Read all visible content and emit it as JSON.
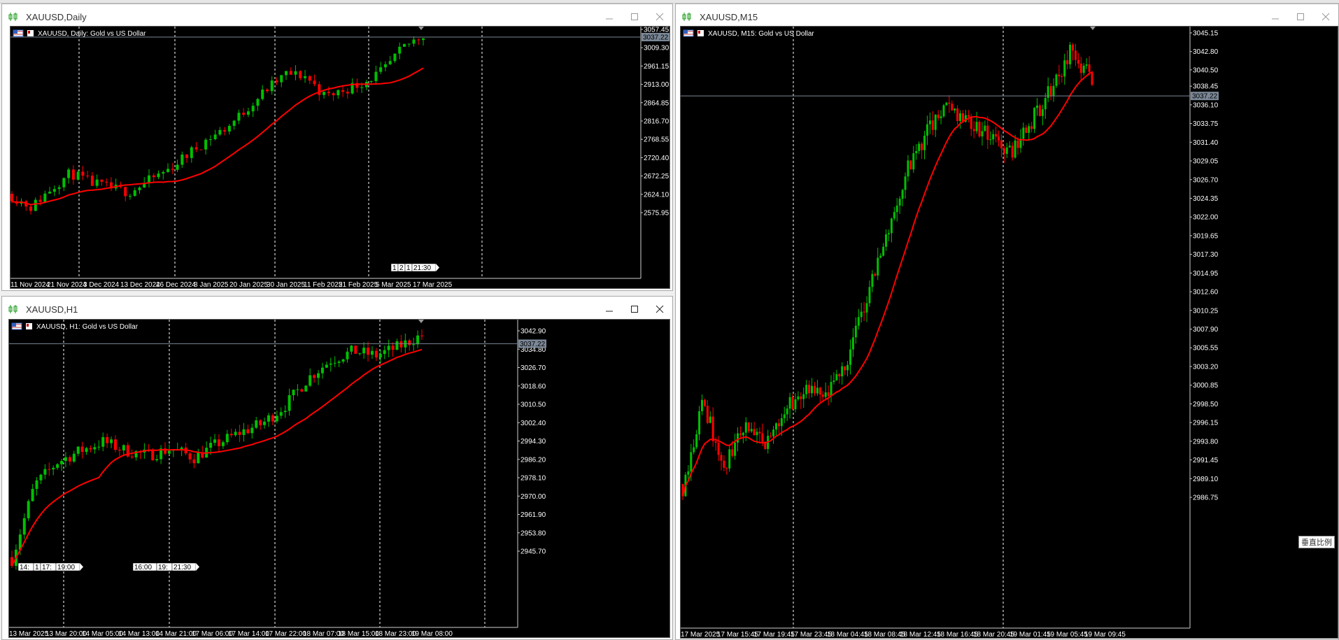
{
  "windows": {
    "daily": {
      "title": "XAUUSD,Daily",
      "header": "XAUUSD, Daily:  Gold vs US Dollar",
      "price_labels": [
        "3057.45",
        "3009.30",
        "2961.15",
        "2913.00",
        "2864.85",
        "2816.70",
        "2768.55",
        "2720.40",
        "2672.25",
        "2624.10",
        "2575.95"
      ],
      "date_labels": [
        "11 Nov 2024",
        "21 Nov 2024",
        "3 Dec 2024",
        "13 Dec 2024",
        "26 Dec 2024",
        "8 Jan 2025",
        "20 Jan 2025",
        "30 Jan 2025",
        "11 Feb 2025",
        "21 Feb 2025",
        "5 Mar 2025",
        "17 Mar 2025"
      ],
      "current_price": "3037.22",
      "countdown": "1|2|1|21:30"
    },
    "h1": {
      "title": "XAUUSD,H1",
      "header": "XAUUSD, H1:  Gold vs US Dollar",
      "price_labels": [
        "3042.90",
        "3034.80",
        "3026.70",
        "3018.60",
        "3010.50",
        "3002.40",
        "2994.30",
        "2986.20",
        "2978.10",
        "2970.00",
        "2961.90",
        "2953.80",
        "2945.70"
      ],
      "date_labels": [
        "13 Mar 2025",
        "13 Mar 20:00",
        "14 Mar 05:00",
        "14 Mar 13:00",
        "14 Mar 21:00",
        "17 Mar 06:00",
        "17 Mar 14:00",
        "17 Mar 22:00",
        "18 Mar 07:00",
        "18 Mar 15:00",
        "18 Mar 23:00",
        "19 Mar 08:00"
      ],
      "current_price": "3037.22",
      "countdown_left": "14:|1|17:|19:00",
      "countdown_mid": "16:00|19:|21:30"
    },
    "m15": {
      "title": "XAUUSD,M15",
      "header": "XAUUSD, M15:  Gold vs US Dollar",
      "price_labels": [
        "3045.15",
        "3042.80",
        "3040.50",
        "3038.45",
        "3036.10",
        "3033.75",
        "3031.40",
        "3029.05",
        "3026.70",
        "3024.35",
        "3022.00",
        "3019.65",
        "3017.30",
        "3014.95",
        "3012.60",
        "3010.25",
        "3007.90",
        "3005.55",
        "3003.20",
        "3000.85",
        "2998.50",
        "2996.15",
        "2993.80",
        "2991.45",
        "2989.10",
        "2986.75"
      ],
      "date_labels": [
        "17 Mar 2025",
        "17 Mar 15:45",
        "17 Mar 19:45",
        "17 Mar 23:45",
        "18 Mar 04:45",
        "18 Mar 08:45",
        "18 Mar 12:45",
        "18 Mar 16:45",
        "18 Mar 20:45",
        "19 Mar 01:45",
        "19 Mar 05:45",
        "19 Mar 09:45"
      ],
      "current_price": "3037.22",
      "tooltip": "垂直比例"
    }
  },
  "colors": {
    "bull": "#00c000",
    "bear": "#ff0000",
    "ma": "#ff0000",
    "grid": "#ffffff",
    "bg": "#000000",
    "price_line": "#7a8797"
  }
}
